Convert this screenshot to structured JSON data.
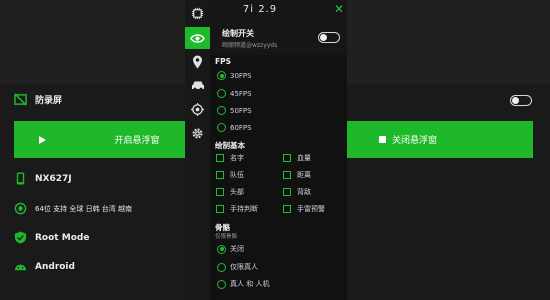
{
  "menu": {
    "title": "7i 2.9",
    "draw_switch": {
      "label": "绘制开关",
      "subtitle": "绚丽频道@wzzyyds"
    },
    "fps": {
      "title": "FPS",
      "options": [
        {
          "label": "30FPS",
          "selected": true
        },
        {
          "label": "45FPS",
          "selected": false
        },
        {
          "label": "50FPS",
          "selected": false
        },
        {
          "label": "60FPS",
          "selected": false
        }
      ]
    },
    "basic": {
      "title": "绘制基本",
      "items": [
        "名字",
        "血量",
        "队伍",
        "距离",
        "头部",
        "背敌",
        "手持判断",
        "手雷预警"
      ]
    },
    "bone": {
      "title": "骨骼",
      "subtitle": "仅限骨骼",
      "options": [
        {
          "label": "关闭",
          "selected": true
        },
        {
          "label": "仅限真人",
          "selected": false
        },
        {
          "label": "真人 和 人机",
          "selected": false
        }
      ]
    }
  },
  "app": {
    "record_label": "防录屏",
    "start_button": "开启悬浮窗",
    "close_button": "关闭悬浮窗",
    "device": "NX627J",
    "support": "64位 支持 全球 日韩 台湾 越南",
    "root": "Root Mode",
    "os": "Android"
  },
  "colors": {
    "accent": "#1eb82a",
    "bg": "#1f1f1f",
    "menu_bg": "#111111"
  },
  "sidebar_icons": [
    "chip-icon",
    "eye-icon",
    "location-icon",
    "car-icon",
    "target-icon",
    "gear-icon"
  ]
}
